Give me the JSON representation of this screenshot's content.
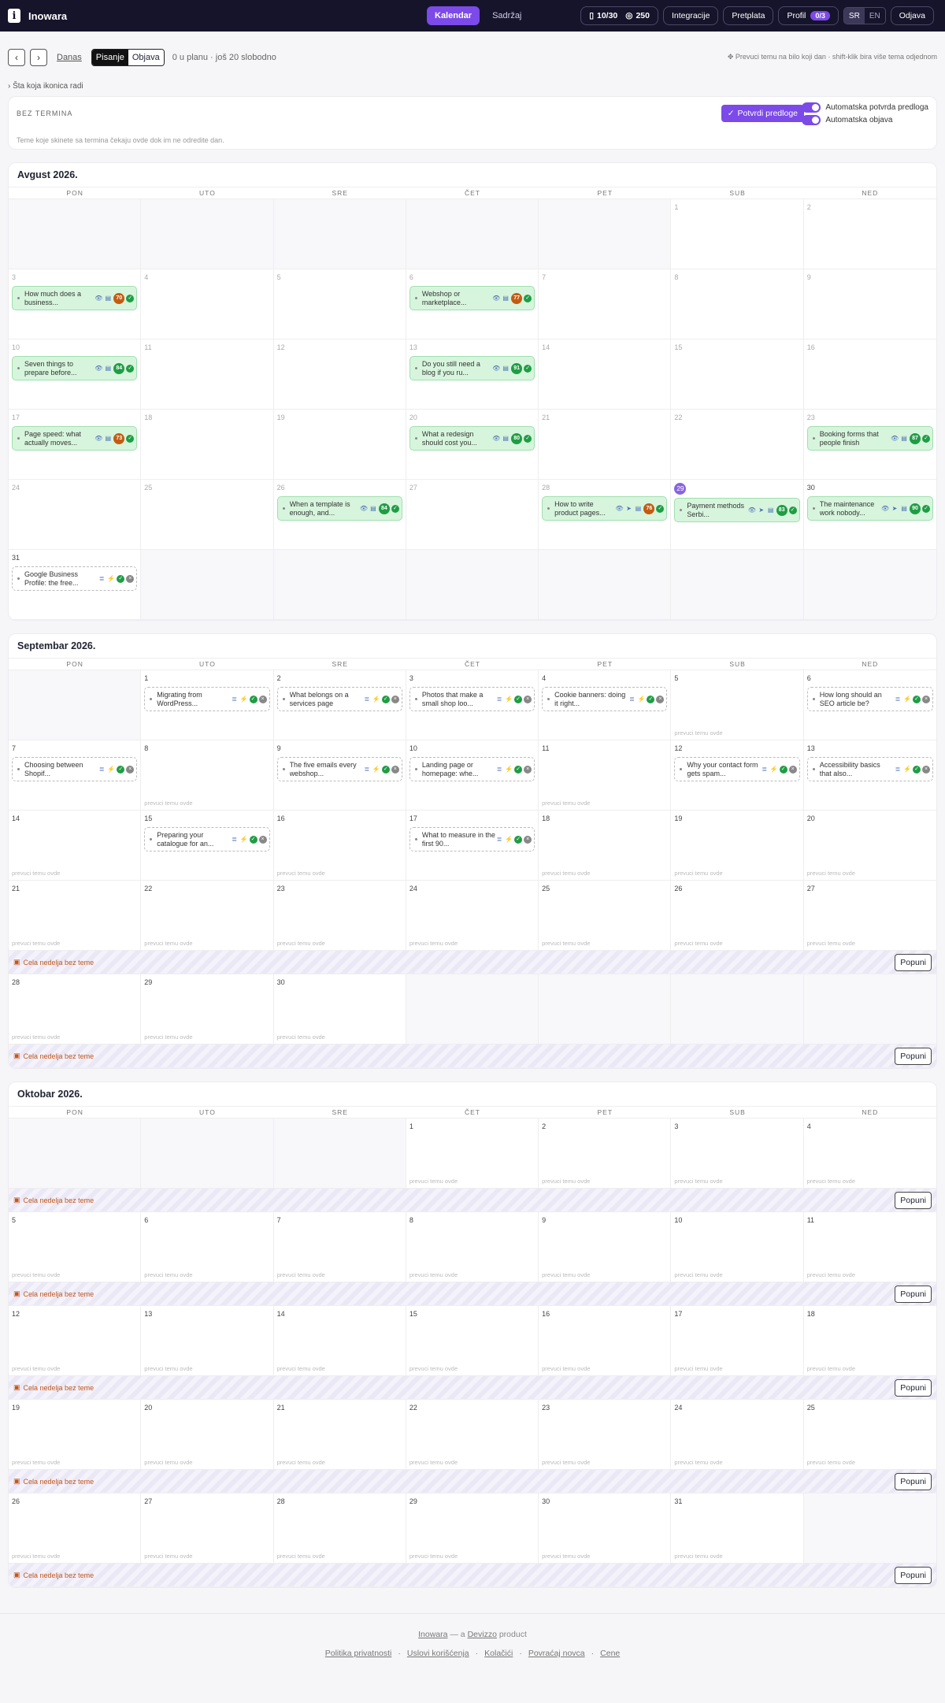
{
  "app": {
    "name": "Inowara",
    "logo_glyph": "i"
  },
  "nav": {
    "tabs": [
      "Kalendar",
      "Sadržaj"
    ],
    "active": 0
  },
  "topright": {
    "quota": "10/30",
    "credits": "250",
    "integrations": "Integracije",
    "subscription": "Pretplata",
    "profile": "Profil",
    "profile_badge": "0/3",
    "lang": [
      "SR",
      "EN"
    ],
    "logout": "Odjava"
  },
  "toolbar": {
    "today": "Danas",
    "modes": [
      "Pisanje",
      "Objava"
    ],
    "plan_note": "0 u planu · još 20 slobodno",
    "drag_hint": "Prevuci temu na bilo koji dan · shift-klik bira više tema odjednom"
  },
  "help_link": "Šta koja ikonica radi",
  "bez_termina": {
    "title": "BEZ TERMINA",
    "desc": "Teme koje skinete sa termina čekaju ovde dok im ne odredite dan.",
    "confirm": "Potvrdi predloge",
    "toggle1": "Automatska potvrda predloga",
    "toggle2": "Automatska objava"
  },
  "dow": [
    "PON",
    "UTO",
    "SRE",
    "ČET",
    "PET",
    "SUB",
    "NED"
  ],
  "labels": {
    "drop": "prevuci temu ovde",
    "empty_week": "Cela nedelja bez teme",
    "fill": "Popuni"
  },
  "colors": {
    "accent": "#7b4ae8",
    "ok": "#1f9d44",
    "warn": "#c45b12"
  },
  "months": [
    {
      "title": "Avgust 2026.",
      "weeks": [
        {
          "days": [
            null,
            null,
            null,
            null,
            null,
            {
              "n": "1",
              "past": true
            },
            {
              "n": "2",
              "past": true
            }
          ]
        },
        {
          "days": [
            {
              "n": "3",
              "past": true,
              "card": {
                "k": "ok",
                "t": "How much does a business...",
                "s": "70",
                "sc": "o",
                "i": [
                  "eye",
                  "doc"
                ]
              }
            },
            {
              "n": "4",
              "past": true
            },
            {
              "n": "5",
              "past": true
            },
            {
              "n": "6",
              "past": true,
              "card": {
                "k": "ok",
                "t": "Webshop or marketplace...",
                "s": "77",
                "sc": "o",
                "i": [
                  "eye",
                  "doc"
                ]
              }
            },
            {
              "n": "7",
              "past": true
            },
            {
              "n": "8",
              "past": true
            },
            {
              "n": "9",
              "past": true
            }
          ]
        },
        {
          "days": [
            {
              "n": "10",
              "past": true,
              "card": {
                "k": "ok",
                "t": "Seven things to prepare before...",
                "s": "84",
                "sc": "g",
                "i": [
                  "eye",
                  "doc"
                ]
              }
            },
            {
              "n": "11",
              "past": true
            },
            {
              "n": "12",
              "past": true
            },
            {
              "n": "13",
              "past": true,
              "card": {
                "k": "ok",
                "t": "Do you still need a blog if you ru...",
                "s": "91",
                "sc": "g",
                "i": [
                  "eye",
                  "doc"
                ]
              }
            },
            {
              "n": "14",
              "past": true
            },
            {
              "n": "15",
              "past": true
            },
            {
              "n": "16",
              "past": true
            }
          ]
        },
        {
          "days": [
            {
              "n": "17",
              "past": true,
              "card": {
                "k": "ok",
                "t": "Page speed: what actually moves...",
                "s": "73",
                "sc": "o",
                "i": [
                  "eye",
                  "doc"
                ]
              }
            },
            {
              "n": "18",
              "past": true
            },
            {
              "n": "19",
              "past": true
            },
            {
              "n": "20",
              "past": true,
              "card": {
                "k": "ok",
                "t": "What a redesign should cost you...",
                "s": "80",
                "sc": "g",
                "i": [
                  "eye",
                  "doc"
                ]
              }
            },
            {
              "n": "21",
              "past": true
            },
            {
              "n": "22",
              "past": true
            },
            {
              "n": "23",
              "past": true,
              "card": {
                "k": "ok",
                "t": "Booking forms that people finish",
                "s": "87",
                "sc": "g",
                "i": [
                  "eye",
                  "doc"
                ]
              }
            }
          ]
        },
        {
          "days": [
            {
              "n": "24",
              "past": true
            },
            {
              "n": "25",
              "past": true
            },
            {
              "n": "26",
              "past": true,
              "card": {
                "k": "ok",
                "t": "When a template is enough, and...",
                "s": "84",
                "sc": "g",
                "i": [
                  "eye",
                  "doc"
                ]
              }
            },
            {
              "n": "27",
              "past": true
            },
            {
              "n": "28",
              "past": true,
              "card": {
                "k": "ok",
                "t": "How to write product pages...",
                "s": "76",
                "sc": "o",
                "i": [
                  "eye",
                  "send",
                  "doc"
                ]
              }
            },
            {
              "n": "29",
              "today": true,
              "card": {
                "k": "ok",
                "t": "Payment methods Serbi...",
                "s": "83",
                "sc": "g",
                "i": [
                  "eye",
                  "send",
                  "doc"
                ]
              }
            },
            {
              "n": "30",
              "card": {
                "k": "ok",
                "t": "The maintenance work nobody...",
                "s": "90",
                "sc": "g",
                "i": [
                  "eye",
                  "send",
                  "doc"
                ]
              }
            }
          ]
        },
        {
          "days": [
            {
              "n": "31",
              "card": {
                "k": "plan",
                "t": "Google Business Profile: the free...",
                "i": [
                  "list",
                  "bolt"
                ]
              }
            },
            null,
            null,
            null,
            null,
            null,
            null
          ]
        }
      ]
    },
    {
      "title": "Septembar 2026.",
      "weeks": [
        {
          "days": [
            null,
            {
              "n": "1",
              "card": {
                "k": "plan",
                "t": "Migrating from WordPress...",
                "i": [
                  "list",
                  "bolt"
                ]
              }
            },
            {
              "n": "2",
              "card": {
                "k": "plan",
                "t": "What belongs on a services page",
                "i": [
                  "list",
                  "bolt"
                ]
              }
            },
            {
              "n": "3",
              "card": {
                "k": "plan",
                "t": "Photos that make a small shop loo...",
                "i": [
                  "list",
                  "bolt"
                ]
              }
            },
            {
              "n": "4",
              "card": {
                "k": "plan",
                "t": "Cookie banners: doing it right...",
                "i": [
                  "list",
                  "bolt"
                ]
              }
            },
            {
              "n": "5",
              "drop": true
            },
            {
              "n": "6",
              "card": {
                "k": "plan",
                "t": "How long should an SEO article be?",
                "i": [
                  "list",
                  "bolt"
                ]
              }
            }
          ]
        },
        {
          "days": [
            {
              "n": "7",
              "card": {
                "k": "plan",
                "t": "Choosing between Shopif...",
                "i": [
                  "list",
                  "bolt"
                ]
              }
            },
            {
              "n": "8",
              "drop": true
            },
            {
              "n": "9",
              "card": {
                "k": "plan",
                "t": "The five emails every webshop...",
                "i": [
                  "list",
                  "bolt"
                ]
              }
            },
            {
              "n": "10",
              "card": {
                "k": "plan",
                "t": "Landing page or homepage: whe...",
                "i": [
                  "list",
                  "bolt"
                ]
              }
            },
            {
              "n": "11",
              "drop": true
            },
            {
              "n": "12",
              "card": {
                "k": "plan",
                "t": "Why your contact form gets spam...",
                "i": [
                  "list",
                  "bolt"
                ]
              }
            },
            {
              "n": "13",
              "card": {
                "k": "plan",
                "t": "Accessibility basics that also...",
                "i": [
                  "list",
                  "bolt"
                ]
              }
            }
          ]
        },
        {
          "days": [
            {
              "n": "14",
              "drop": true
            },
            {
              "n": "15",
              "card": {
                "k": "plan",
                "t": "Preparing your catalogue for an...",
                "i": [
                  "list",
                  "bolt"
                ]
              }
            },
            {
              "n": "16",
              "drop": true
            },
            {
              "n": "17",
              "card": {
                "k": "plan",
                "t": "What to measure in the first 90...",
                "i": [
                  "list",
                  "bolt"
                ]
              }
            },
            {
              "n": "18",
              "drop": true
            },
            {
              "n": "19",
              "drop": true
            },
            {
              "n": "20",
              "drop": true
            }
          ]
        },
        {
          "days": [
            {
              "n": "21",
              "drop": true
            },
            {
              "n": "22",
              "drop": true
            },
            {
              "n": "23",
              "drop": true
            },
            {
              "n": "24",
              "drop": true
            },
            {
              "n": "25",
              "drop": true
            },
            {
              "n": "26",
              "drop": true
            },
            {
              "n": "27",
              "drop": true
            }
          ],
          "bar": true
        },
        {
          "days": [
            {
              "n": "28",
              "drop": true
            },
            {
              "n": "29",
              "drop": true
            },
            {
              "n": "30",
              "drop": true
            },
            null,
            null,
            null,
            null
          ],
          "bar": true
        }
      ]
    },
    {
      "title": "Oktobar 2026.",
      "weeks": [
        {
          "days": [
            null,
            null,
            null,
            {
              "n": "1",
              "drop": true
            },
            {
              "n": "2",
              "drop": true
            },
            {
              "n": "3",
              "drop": true
            },
            {
              "n": "4",
              "drop": true
            }
          ],
          "bar": true
        },
        {
          "days": [
            {
              "n": "5",
              "drop": true
            },
            {
              "n": "6",
              "drop": true
            },
            {
              "n": "7",
              "drop": true
            },
            {
              "n": "8",
              "drop": true
            },
            {
              "n": "9",
              "drop": true
            },
            {
              "n": "10",
              "drop": true
            },
            {
              "n": "11",
              "drop": true
            }
          ],
          "bar": true
        },
        {
          "days": [
            {
              "n": "12",
              "drop": true
            },
            {
              "n": "13",
              "drop": true
            },
            {
              "n": "14",
              "drop": true
            },
            {
              "n": "15",
              "drop": true
            },
            {
              "n": "16",
              "drop": true
            },
            {
              "n": "17",
              "drop": true
            },
            {
              "n": "18",
              "drop": true
            }
          ],
          "bar": true
        },
        {
          "days": [
            {
              "n": "19",
              "drop": true
            },
            {
              "n": "20",
              "drop": true
            },
            {
              "n": "21",
              "drop": true
            },
            {
              "n": "22",
              "drop": true
            },
            {
              "n": "23",
              "drop": true
            },
            {
              "n": "24",
              "drop": true
            },
            {
              "n": "25",
              "drop": true
            }
          ],
          "bar": true
        },
        {
          "days": [
            {
              "n": "26",
              "drop": true
            },
            {
              "n": "27",
              "drop": true
            },
            {
              "n": "28",
              "drop": true
            },
            {
              "n": "29",
              "drop": true
            },
            {
              "n": "30",
              "drop": true
            },
            {
              "n": "31",
              "drop": true
            },
            null
          ],
          "bar": true
        }
      ]
    }
  ],
  "footer": {
    "brand": "Inowara",
    "mid": " — a ",
    "parent": "Devizzo",
    "tail": " product",
    "links": [
      "Politika privatnosti",
      "Uslovi korišćenja",
      "Kolačići",
      "Povraćaj novca",
      "Cene"
    ]
  }
}
